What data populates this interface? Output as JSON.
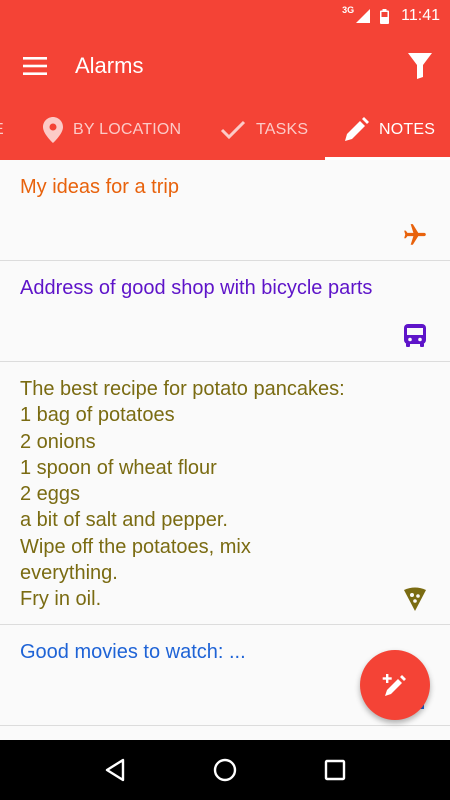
{
  "status_bar": {
    "network": "3G",
    "time": "11:41"
  },
  "toolbar": {
    "title": "Alarms",
    "menu_icon": "hamburger-menu-icon",
    "filter_icon": "filter-icon"
  },
  "tabs": [
    {
      "label": "E",
      "icon": "none",
      "active": false
    },
    {
      "label": "BY LOCATION",
      "icon": "location-pin-icon",
      "active": false
    },
    {
      "label": "TASKS",
      "icon": "checkmark-icon",
      "active": false
    },
    {
      "label": "NOTES",
      "icon": "pencil-icon",
      "active": true
    }
  ],
  "notes": [
    {
      "text": "My ideas for a trip",
      "color": "#e8620c",
      "icon": "airplane-icon"
    },
    {
      "text": "Address of good shop with bicycle parts",
      "color": "#5e14c9",
      "icon": "bus-icon"
    },
    {
      "text": "The best recipe for potato pancakes:\n1 bag of potatoes\n2 onions\n1 spoon of wheat flour\n2 eggs\na bit of salt and pepper.\nWipe off the potatoes, mix everything.\nFry in oil.",
      "color": "#7a6b12",
      "icon": "pizza-icon"
    },
    {
      "text": "Good movies to watch: ...",
      "color": "#1e63d6",
      "icon": "movie-icon"
    }
  ],
  "fab": {
    "icon": "add-note-icon"
  },
  "colors": {
    "primary": "#f44336",
    "background": "#fafafa",
    "divider": "#dcdcdc"
  }
}
